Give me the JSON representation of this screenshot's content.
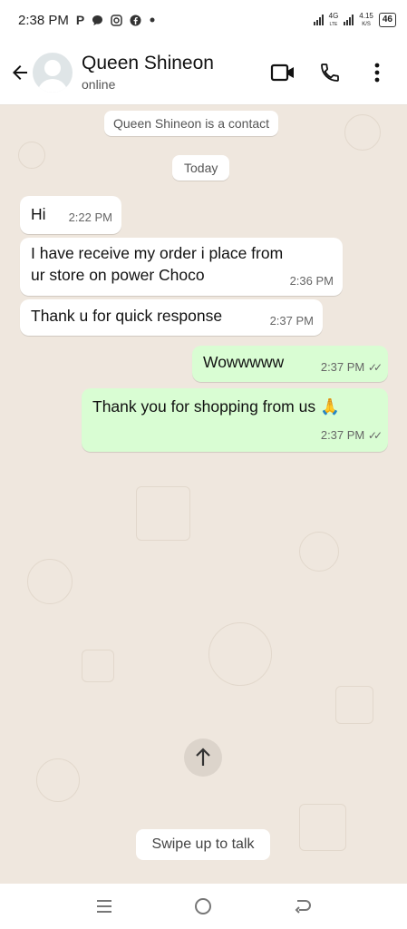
{
  "status_bar": {
    "time": "2:38 PM",
    "notif_p": "P",
    "network_label": "4G",
    "network_sub": "LTE",
    "speed_value": "4.15",
    "speed_unit": "K/S",
    "battery": "46"
  },
  "header": {
    "contact_name": "Queen Shineon",
    "contact_status": "online"
  },
  "chat": {
    "system_notice": "Queen Shineon is a contact",
    "date_label": "Today",
    "messages": [
      {
        "direction": "in",
        "text": "Hi",
        "time": "2:22 PM"
      },
      {
        "direction": "in",
        "text_line1": "I have receive my order i place from",
        "text_line2": "ur store on power Choco",
        "time": "2:36 PM"
      },
      {
        "direction": "in",
        "text": "Thank u for quick response",
        "time": "2:37 PM"
      },
      {
        "direction": "out",
        "text": "Wowwwww",
        "time": "2:37 PM",
        "status": "read"
      },
      {
        "direction": "out",
        "text": "Thank you for shopping from us",
        "emoji": "🙏",
        "time": "2:37 PM",
        "status": "read"
      }
    ],
    "swipe_hint": "Swipe up to talk"
  },
  "colors": {
    "chat_bg": "#efe7de",
    "outgoing_bubble": "#d9fdd3",
    "incoming_bubble": "#ffffff"
  },
  "icons": {
    "back": "arrow-left-icon",
    "video": "video-call-icon",
    "phone": "phone-icon",
    "menu": "more-vert-icon",
    "scroll": "arrow-up-icon",
    "nav_menu": "menu-icon",
    "nav_home": "home-circle-icon",
    "nav_back": "back-icon"
  }
}
